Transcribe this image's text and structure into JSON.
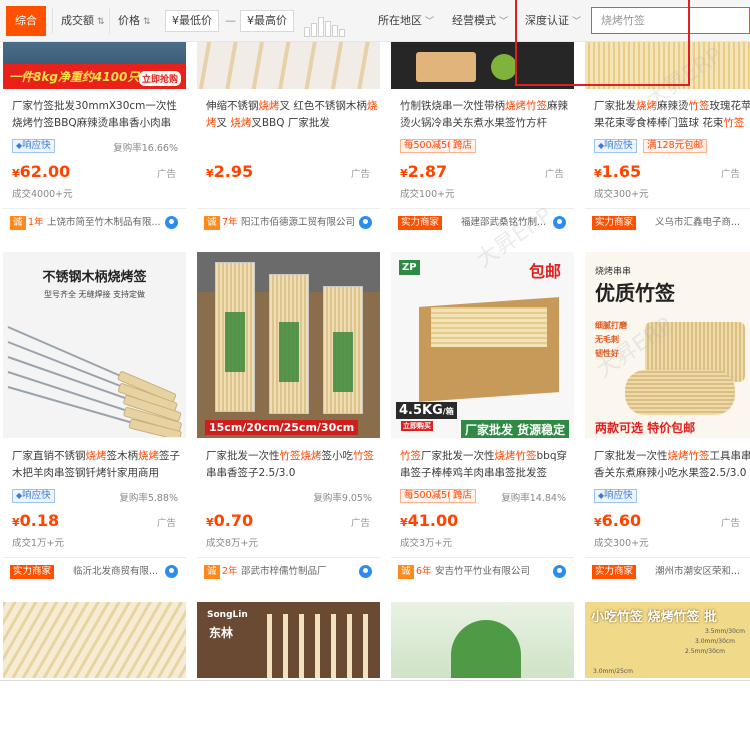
{
  "filter_bar": {
    "tab_active": "综合",
    "sort_sales": "成交额",
    "sort_price": "价格",
    "min_price_placeholder": "¥最低价",
    "dash": "—",
    "max_price_placeholder": "¥最高价",
    "region": "所在地区",
    "mode": "经营模式",
    "depth_cert": "深度认证",
    "search_value": "烧烤竹签"
  },
  "row1": [
    {
      "title_parts": [
        "厂家竹签批发30mmX30cm一次性烧烤竹签BBQ麻辣烫串串香小肉串",
        ""
      ],
      "badge1": "响应快",
      "badge2": "",
      "rate": "复购率16.66%",
      "price": "62.00",
      "ad": "广告",
      "sold": "成交4000+元",
      "shop_tag": "",
      "shop_year": "1年",
      "shop_name": "上饶市简至竹木制品有限..."
    },
    {
      "title_parts": [
        "伸缩不锈钢",
        "烧烤",
        "叉 红色不锈钢木柄",
        "烧",
        "烤",
        "叉 ",
        "烧烤",
        "叉BBQ 厂家批发"
      ],
      "badge1": "",
      "badge2": "",
      "rate": "",
      "price": "2.95",
      "ad": "广告",
      "sold": "",
      "shop_tag": "",
      "shop_year": "7年",
      "shop_name": "阳江市佰德源工贸有限公司"
    },
    {
      "title_parts": [
        "竹制铁烧串一次性带柄",
        "烧烤",
        "竹签",
        "麻辣烫火锅冷串关东煮水果签竹方杆"
      ],
      "badge1": "每500减50",
      "badge2": "跨店",
      "rate": "",
      "price": "2.87",
      "ad": "广告",
      "sold": "成交100+元",
      "shop_tag": "实力商家",
      "shop_year": "",
      "shop_name": "福建邵武桑铭竹制..."
    },
    {
      "title_parts": [
        "厂家批发",
        "烧烤",
        "麻辣烫",
        "竹签",
        "玫瑰花苹果花束零食棒棒门篮球 花束",
        "竹",
        "签"
      ],
      "badge1": "响应快",
      "badge2": "满128元包邮",
      "rate": "",
      "price": "1.65",
      "ad": "广告",
      "sold": "成交300+元",
      "shop_tag": "实力商家",
      "shop_year": "",
      "shop_name": "义乌市汇鑫电子商..."
    }
  ],
  "row2": [
    {
      "title_parts": [
        "厂家直销不锈钢",
        "烧烤",
        "签木柄",
        "烧烤",
        "签子木把羊肉串签钢钎烤针家用商用"
      ],
      "badge1": "响应快",
      "badge2": "",
      "rate": "复购率5.88%",
      "price": "0.18",
      "ad": "广告",
      "sold": "成交1万+元",
      "shop_tag": "实力商家",
      "shop_year": "",
      "shop_name": "临沂北发商贸有限..."
    },
    {
      "title_parts": [
        "厂家批发一次性",
        "竹签",
        "烧烤",
        "签小吃",
        "竹签",
        "串串香签子2.5/3.0"
      ],
      "badge1": "",
      "badge2": "",
      "rate": "复购率9.05%",
      "price": "0.70",
      "ad": "广告",
      "sold": "成交8万+元",
      "shop_tag": "",
      "shop_year": "2年",
      "shop_name": "邵武市梓儒竹制品厂"
    },
    {
      "title_parts": [
        "竹签",
        "厂家批发一次性",
        "烧烤",
        "竹签",
        "bbq穿串签子棒棒鸡羊肉串串签批发签"
      ],
      "badge1": "每500减50",
      "badge2": "跨店",
      "rate": "复购率14.84%",
      "price": "41.00",
      "ad": "",
      "sold": "成交3万+元",
      "shop_tag": "",
      "shop_year": "6年",
      "shop_name": "安吉竹平竹业有限公司"
    },
    {
      "title_parts": [
        "厂家批发一次性",
        "烧烤",
        "竹签",
        "工具串串香关东煮麻辣小吃水果签2.5/3.0"
      ],
      "badge1": "响应快",
      "badge2": "",
      "rate": "",
      "price": "6.60",
      "ad": "广告",
      "sold": "成交300+元",
      "shop_tag": "实力商家",
      "shop_year": "",
      "shop_name": "潮州市潮安区荣和..."
    }
  ],
  "banner_texts": {
    "r1c1_red": "一件8kg净重约4100只",
    "r1c1_btn": "立即抢购",
    "r2c1_title": "不锈钢木柄烧烤签",
    "r2c1_sub": "型号齐全  无缝焊接  支持定做",
    "r2c2_sizes": "15cm/20cm/25cm/30cm",
    "r2c3_logo": "ZP",
    "r2c3_free": "包邮",
    "r2c3_weight": "4.5KG",
    "r2c3_unit": "/箱",
    "r2c3_btn": "立即购买",
    "r2c3_banner": "厂家批发 货源稳定",
    "r2c4_small": "烧烤串串",
    "r2c4_big": "优质竹签",
    "r2c4_feat1": "细腻打磨",
    "r2c4_feat2": "无毛刺",
    "r2c4_feat3": "韧性好",
    "r2c4_bottom": "两款可选  特价包邮",
    "r3c2_brand_en": "SongLin",
    "r3c2_brand_cn": "东林",
    "r3c4_title": "小吃竹签  烧烤竹签  批",
    "r3c4_dim1": "3.5mm/30cm",
    "r3c4_dim2": "3.0mm/30cm",
    "r3c4_dim3": "2.5mm/30cm",
    "r3c4_dim4": "3.0mm/25cm"
  },
  "watermark": "大昇ERP",
  "colors": {
    "accent": "#ff5000",
    "price": "#ff4400",
    "highlight_box": "#e02020"
  }
}
